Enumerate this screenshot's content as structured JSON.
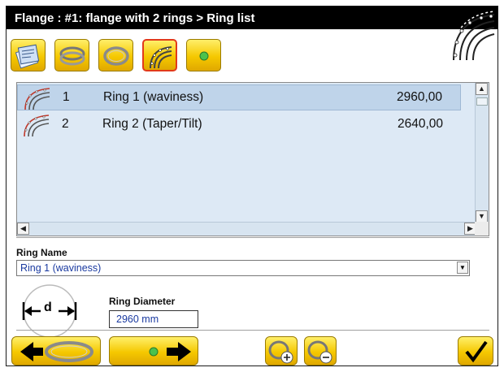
{
  "window": {
    "title": "Flange :  #1: flange with 2 rings > Ring list",
    "corner_icon": "ring-segment-icon"
  },
  "toolbar": {
    "buttons": [
      {
        "name": "flange-sheet-button",
        "icon": "flange-sheet-icon",
        "active": false
      },
      {
        "name": "flange-rings-button",
        "icon": "double-ring-icon",
        "active": false
      },
      {
        "name": "single-ring-button",
        "icon": "ring-icon",
        "active": false
      },
      {
        "name": "ring-list-button",
        "icon": "ring-segment-icon",
        "active": true
      },
      {
        "name": "green-dot-button",
        "icon": "green-dot-icon",
        "active": false
      }
    ]
  },
  "ring_list": {
    "rows": [
      {
        "num": "1",
        "name": "Ring 1 (waviness)",
        "diameter": "2960,00",
        "selected": true
      },
      {
        "num": "2",
        "name": "Ring 2 (Taper/Tilt)",
        "diameter": "2640,00",
        "selected": false
      }
    ]
  },
  "form": {
    "ring_name_label": "Ring Name",
    "ring_name_value": "Ring 1 (waviness)",
    "ring_diameter_label": "Ring Diameter",
    "ring_diameter_value": "2960 mm",
    "diameter_symbol": "d"
  },
  "bottom_bar": {
    "prev_icon": "arrow-left-ring-icon",
    "next_icon": "arrow-right-dot-icon",
    "add_ring_icon": "add-ring-icon",
    "remove_ring_icon": "remove-ring-icon",
    "confirm_icon": "checkmark-icon"
  },
  "colors": {
    "accent_yellow": "#f5c800",
    "selection": "#bfd4ea",
    "list_background": "#dde9f5",
    "value_text": "#1a3aa0",
    "active_border": "#e23a1a"
  }
}
